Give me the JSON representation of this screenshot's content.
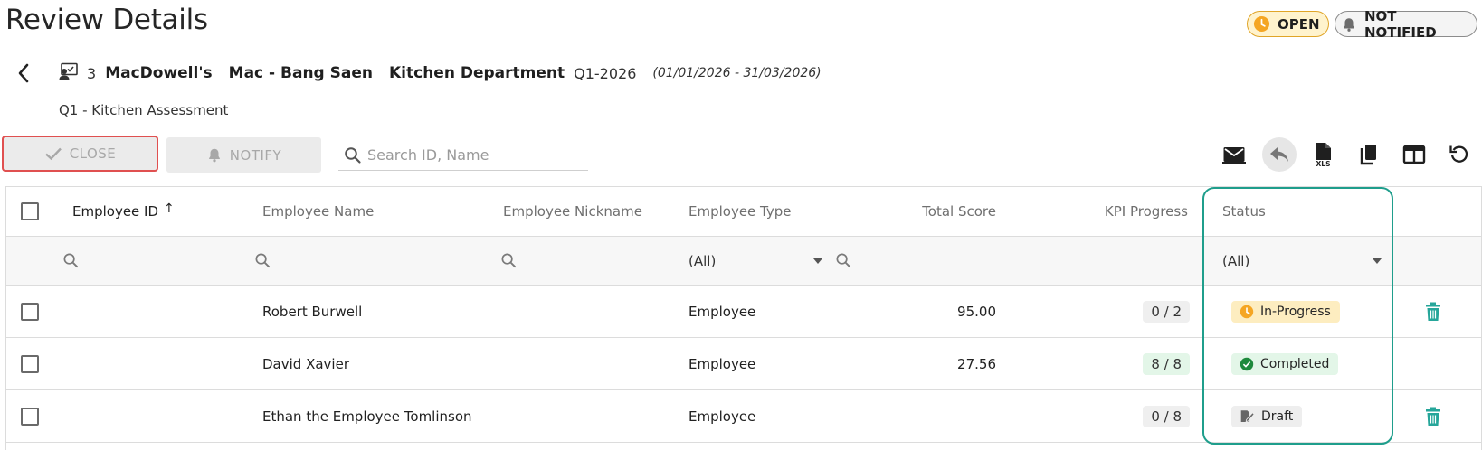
{
  "page": {
    "title": "Review Details"
  },
  "chips": {
    "open": "OPEN",
    "not_notified": "NOT NOTIFIED"
  },
  "context": {
    "count": "3",
    "company": "MacDowell's",
    "branch": "Mac - Bang Saen",
    "department": "Kitchen Department",
    "period": "Q1-2026",
    "range": "(01/01/2026 - 31/03/2026)",
    "assessment": "Q1 - Kitchen Assessment"
  },
  "actions": {
    "close": "CLOSE",
    "notify": "NOTIFY"
  },
  "search": {
    "placeholder": "Search ID, Name"
  },
  "table": {
    "headers": {
      "id": "Employee ID",
      "sort_indicator": "↑",
      "name": "Employee Name",
      "nickname": "Employee Nickname",
      "type": "Employee Type",
      "score": "Total Score",
      "kpi": "KPI Progress",
      "status": "Status"
    },
    "filters": {
      "type": "(All)",
      "status": "(All)"
    },
    "rows": [
      {
        "id": "",
        "name": "Robert Burwell",
        "nickname": "",
        "type": "Employee",
        "score": "95.00",
        "kpi": "0 / 2",
        "status": "In-Progress"
      },
      {
        "id": "",
        "name": "David Xavier",
        "nickname": "",
        "type": "Employee",
        "score": "27.56",
        "kpi": "8 / 8",
        "status": "Completed"
      },
      {
        "id": "",
        "name": "Ethan the Employee Tomlinson",
        "nickname": "",
        "type": "Employee",
        "score": "",
        "kpi": "0 / 8",
        "status": "Draft"
      }
    ]
  },
  "colors": {
    "open_accent": "#e0a528",
    "close_highlight": "#e05050",
    "status_highlight": "#1f9e8c",
    "completed": "#1e8a3c",
    "delete": "#26a69a"
  },
  "icons": {
    "back": "chevron-left-icon",
    "count": "assignment-icon",
    "search": "search-icon",
    "toolbar": [
      "email-icon",
      "undo-icon",
      "xls-export-icon",
      "copy-icon",
      "columns-icon",
      "refresh-icon"
    ]
  }
}
